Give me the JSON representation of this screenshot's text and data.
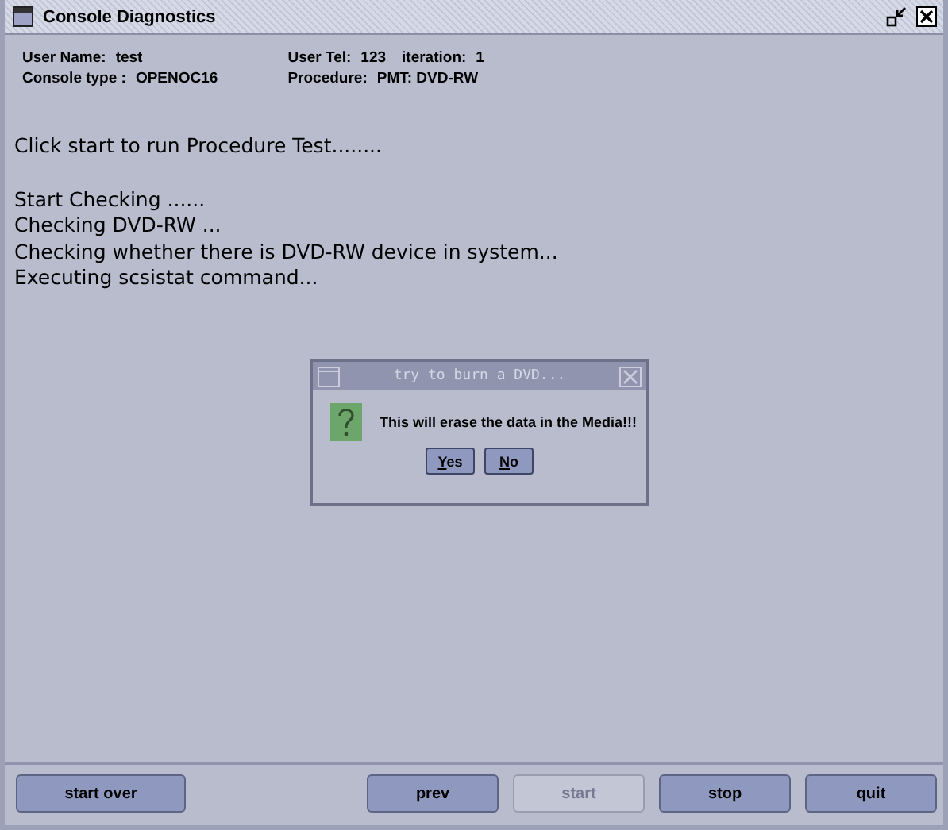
{
  "window": {
    "title": "Console Diagnostics"
  },
  "info": [
    {
      "label": "User Name:",
      "value": "test"
    },
    {
      "label": "User Tel:",
      "value": "123"
    },
    {
      "label": "iteration:",
      "value": "1"
    },
    {
      "label": "Console type :",
      "value": "OPENOC16"
    },
    {
      "label": "Procedure:",
      "value": "PMT: DVD-RW"
    }
  ],
  "log": [
    [
      "Click start to run Procedure Test........"
    ],
    [
      "Start Checking ......",
      "Checking DVD-RW ...",
      "Checking whether there is DVD-RW device in system...",
      "Executing scsistat command..."
    ]
  ],
  "dialog": {
    "title": "try to burn a DVD...",
    "message": "This will erase the data in the Media!!!",
    "buttons": [
      "Yes",
      "No"
    ]
  },
  "buttons": [
    {
      "label": "start over",
      "disabled": false
    },
    {
      "label": "prev",
      "disabled": false
    },
    {
      "label": "start",
      "disabled": true
    },
    {
      "label": "stop",
      "disabled": false
    },
    {
      "label": "quit",
      "disabled": false
    }
  ]
}
